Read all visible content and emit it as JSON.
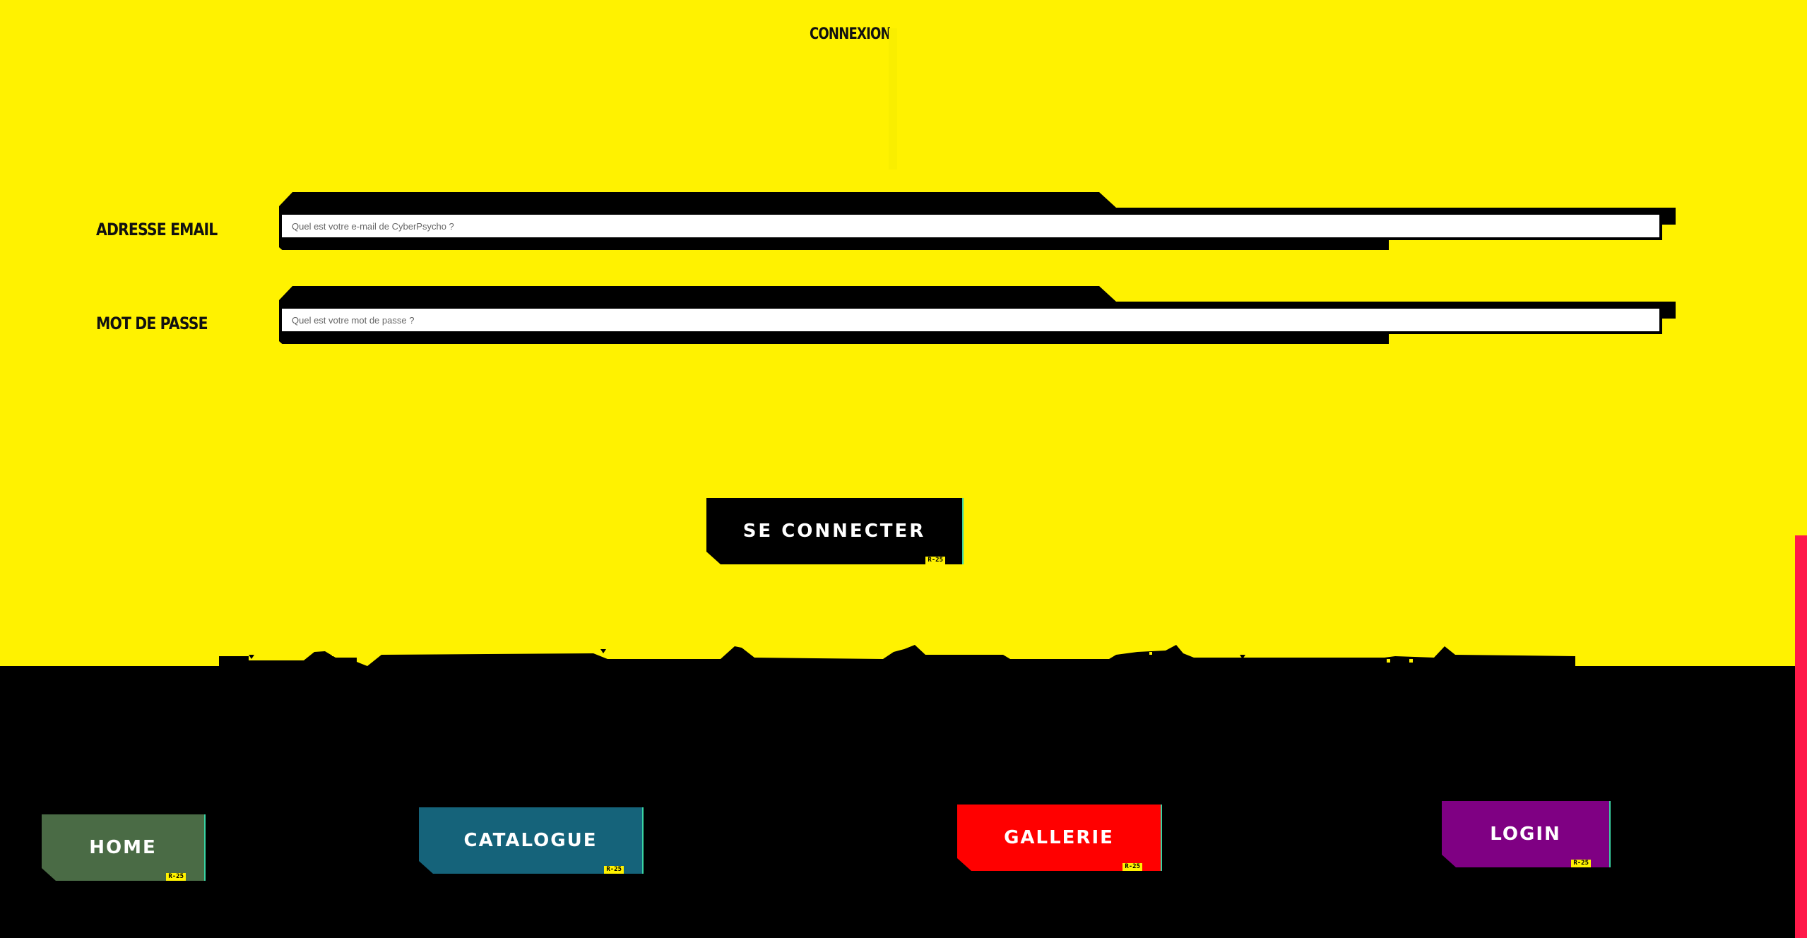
{
  "page": {
    "title": "CONNEXION"
  },
  "form": {
    "email": {
      "label": "ADRESSE EMAIL",
      "placeholder": "Quel est votre e-mail de CyberPsycho ?",
      "value": ""
    },
    "password": {
      "label": "MOT DE PASSE",
      "placeholder": "Quel est votre mot de passe ?",
      "value": ""
    },
    "submit": {
      "label": "SE CONNECTER",
      "tag": "R-25"
    }
  },
  "nav": {
    "items": [
      {
        "label": "HOME",
        "tag": "R-25",
        "color": "#4a6b45"
      },
      {
        "label": "CATALOGUE",
        "tag": "R-25",
        "color": "#15637a"
      },
      {
        "label": "GALLERIE",
        "tag": "R-25",
        "color": "#ff0000"
      },
      {
        "label": "LOGIN",
        "tag": "R-25",
        "color": "#7f0083"
      }
    ]
  },
  "colors": {
    "background": "#fff200",
    "footer": "#000000",
    "accent": "#39d3a3",
    "scroll_accent": "#ff1a4a"
  }
}
